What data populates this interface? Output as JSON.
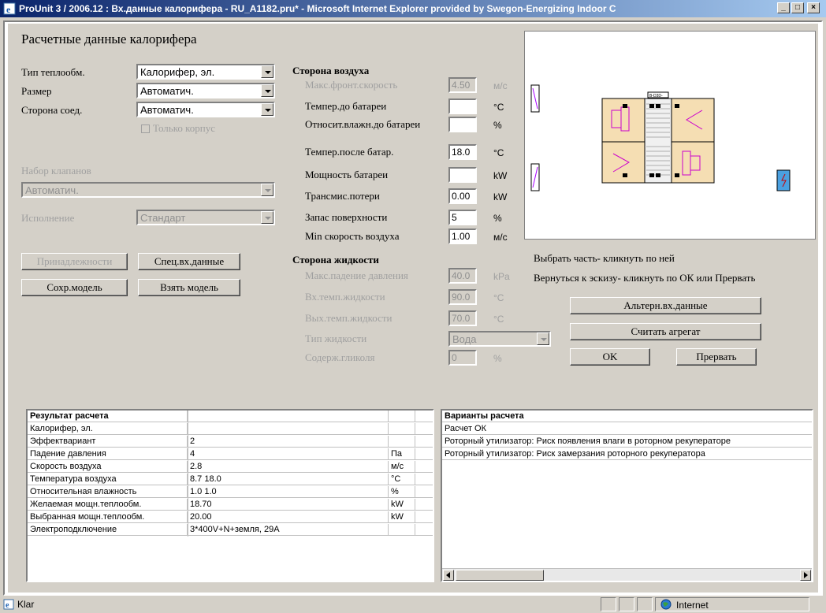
{
  "window": {
    "title": "ProUnit 3 / 2006.12 : Вх.данные калорифера - RU_A1182.pru* - Microsoft Internet Explorer provided by Swegon-Energizing Indoor C",
    "minimize": "_",
    "maximize": "□",
    "close": "×"
  },
  "page": {
    "heading": "Расчетные данные калорифера"
  },
  "left": {
    "type_label": "Тип теплообм.",
    "type_value": "Калорифер, эл.",
    "size_label": "Размер",
    "size_value": "Автоматич.",
    "conn_label": "Сторона соед.",
    "conn_value": "Автоматич.",
    "only_case": "Только корпус",
    "valves_label": "Набор клапанов",
    "valves_value": "Автоматич.",
    "exec_label": "Исполнение",
    "exec_value": "Стандарт",
    "btn_accessories": "Принадлежности",
    "btn_special": "Спец.вх.данные",
    "btn_save": "Сохр.модель",
    "btn_load": "Взять модель"
  },
  "air": {
    "heading": "Сторона воздуха",
    "rows": [
      {
        "label": "Макс.фронт.скорость",
        "value": "4.50",
        "unit": "м/с",
        "disabled": true
      },
      {
        "label": "Темпер.до батареи",
        "value": "",
        "unit": "°C",
        "disabled": false
      },
      {
        "label": "Относит.влажн.до батареи",
        "value": "",
        "unit": "%",
        "disabled": false
      },
      {
        "label": "Темпер.после батар.",
        "value": "18.0",
        "unit": "°C",
        "disabled": false
      },
      {
        "label": "Мощность батареи",
        "value": "",
        "unit": "kW",
        "disabled": false
      },
      {
        "label": "Трансмис.потери",
        "value": "0.00",
        "unit": "kW",
        "disabled": false
      },
      {
        "label": "Запас поверхности",
        "value": "5",
        "unit": "%",
        "disabled": false
      },
      {
        "label": "Min скорость воздуха",
        "value": "1.00",
        "unit": "м/с",
        "disabled": false
      }
    ]
  },
  "liquid": {
    "heading": "Сторона жидкости",
    "rows": [
      {
        "label": "Макс.падение давления",
        "value": "40.0",
        "unit": "kPa"
      },
      {
        "label": "Вх.темп.жидкости",
        "value": "90.0",
        "unit": "°C"
      },
      {
        "label": "Вых.темп.жидкости",
        "value": "70.0",
        "unit": "°C"
      },
      {
        "label": "Тип жидкости",
        "value": "Вода",
        "unit": ""
      },
      {
        "label": "Содерж.гликоля",
        "value": "0",
        "unit": "%"
      }
    ]
  },
  "hints": {
    "line1": "Выбрать часть- кликнуть по ней",
    "line2": "Вернуться к эскизу- кликнуть по ОК или Прервать"
  },
  "right_buttons": {
    "alt": "Альтерн.вх.данные",
    "read": "Считать агрегат",
    "ok": "OK",
    "cancel": "Прервать"
  },
  "diagram": {
    "unit_tag": "B-D3D-"
  },
  "results": {
    "headers": [
      "Результат расчета",
      "",
      ""
    ],
    "rows": [
      [
        "Калорифер, эл.",
        "",
        ""
      ],
      [
        "Эффектвариант",
        "2",
        ""
      ],
      [
        "Падение давления",
        "4",
        "Па"
      ],
      [
        "Скорость воздуха",
        "2.8",
        "м/с"
      ],
      [
        "Температура воздуха",
        "8.7 18.0",
        "°C"
      ],
      [
        "Относительная влажность",
        "1.0 1.0",
        "%"
      ],
      [
        "Желаемая мощн.теплообм.",
        "18.70",
        "kW"
      ],
      [
        "Выбранная мощн.теплообм.",
        "20.00",
        "kW"
      ],
      [
        "Электроподключение",
        "3*400V+N+земля, 29A",
        ""
      ]
    ]
  },
  "variants": {
    "header": "Варианты расчета",
    "rows": [
      "Расчет ОК",
      "Роторный утилизатор: Риск появления влаги в роторном рекуператоре",
      "Роторный утилизатор: Риск замерзания роторного рекуператора"
    ]
  },
  "statusbar": {
    "text": "Klar",
    "zone": "Internet"
  }
}
